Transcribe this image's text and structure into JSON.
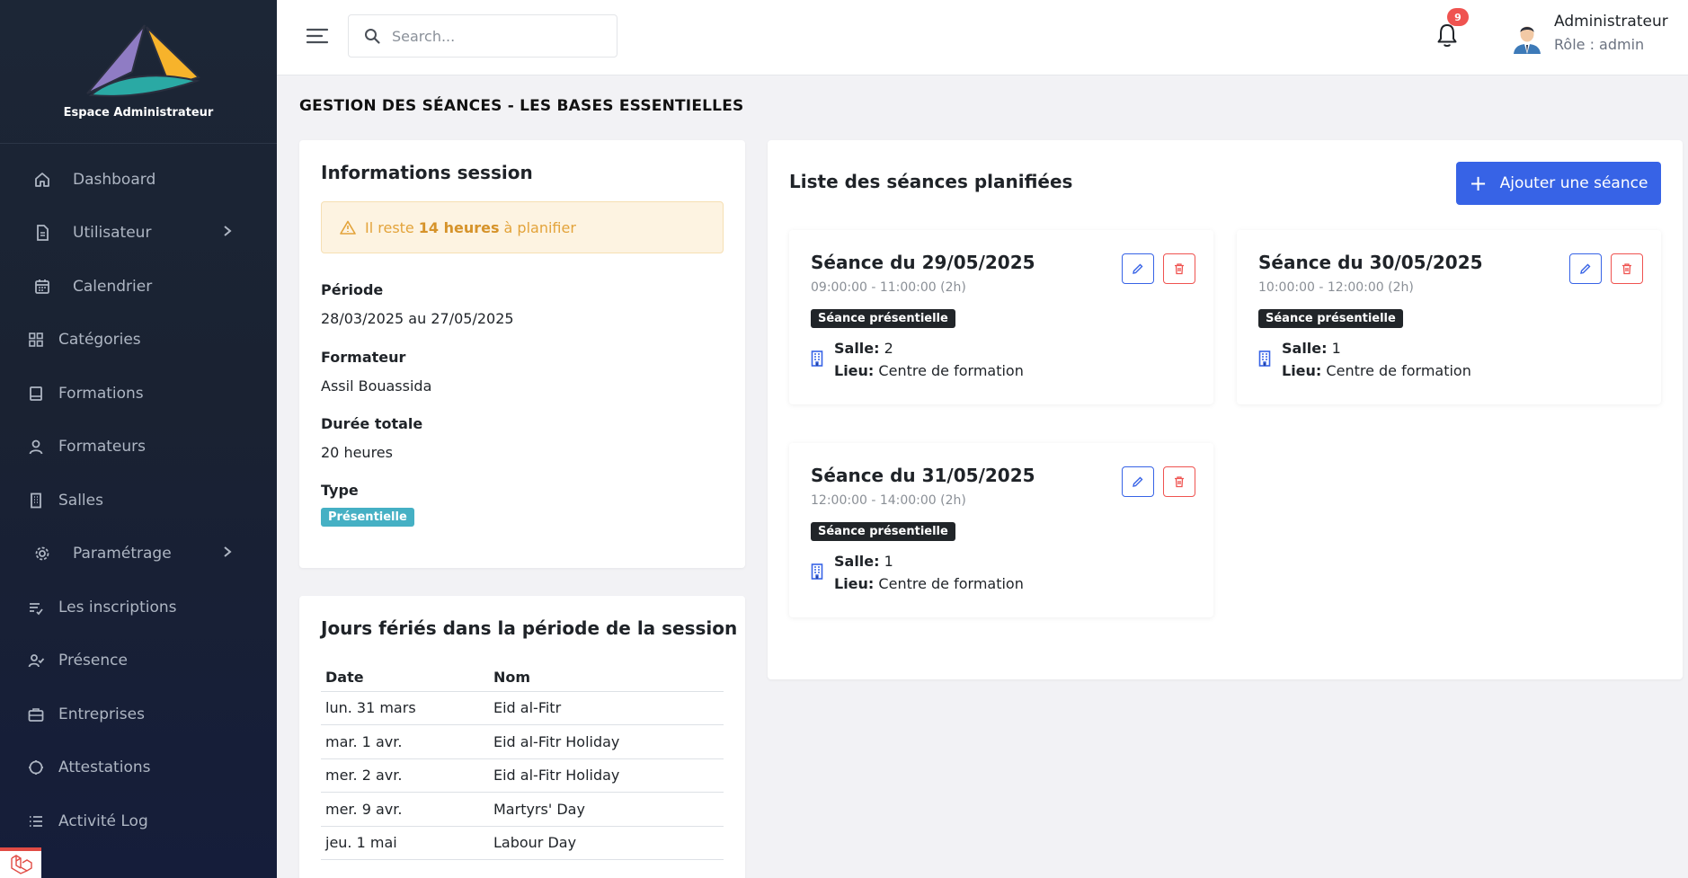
{
  "sidebar": {
    "brand_name": "Espace Administrateur",
    "items": [
      {
        "label": "Dashboard",
        "icon": "home-icon"
      },
      {
        "label": "Utilisateur",
        "icon": "document-icon",
        "has_submenu": true
      },
      {
        "label": "Calendrier",
        "icon": "calendar-icon"
      },
      {
        "label": "Catégories",
        "icon": "grid-icon"
      },
      {
        "label": "Formations",
        "icon": "book-icon"
      },
      {
        "label": "Formateurs",
        "icon": "user-icon"
      },
      {
        "label": "Salles",
        "icon": "building-icon"
      },
      {
        "label": "Paramétrage",
        "icon": "gear-icon",
        "has_submenu": true
      },
      {
        "label": "Les inscriptions",
        "icon": "list-check-icon"
      },
      {
        "label": "Présence",
        "icon": "user-check-icon"
      },
      {
        "label": "Entreprises",
        "icon": "briefcase-icon"
      },
      {
        "label": "Attestations",
        "icon": "badge-icon"
      },
      {
        "label": "Activité Log",
        "icon": "list-icon"
      }
    ]
  },
  "topbar": {
    "search_placeholder": "Search...",
    "notification_count": "9",
    "user_name": "Administrateur",
    "user_role": "Rôle : admin"
  },
  "page": {
    "title": "GESTION DES SÉANCES - LES BASES ESSENTIELLES"
  },
  "info": {
    "title": "Informations session",
    "alert_prefix": "Il reste",
    "alert_highlight": "14 heures",
    "alert_suffix": "à planifier",
    "periode_label": "Période",
    "periode_value": "28/03/2025 au 27/05/2025",
    "formateur_label": "Formateur",
    "formateur_value": "Assil Bouassida",
    "duree_label": "Durée totale",
    "duree_value": "20 heures",
    "type_label": "Type",
    "type_value": "Présentielle"
  },
  "holidays": {
    "title": "Jours fériés dans la période de la session",
    "columns": [
      "Date",
      "Nom"
    ],
    "rows": [
      {
        "date": "lun. 31 mars",
        "name": "Eid al-Fitr"
      },
      {
        "date": "mar. 1 avr.",
        "name": "Eid al-Fitr Holiday"
      },
      {
        "date": "mer. 2 avr.",
        "name": "Eid al-Fitr Holiday"
      },
      {
        "date": "mer. 9 avr.",
        "name": "Martyrs' Day"
      },
      {
        "date": "jeu. 1 mai",
        "name": "Labour Day"
      }
    ]
  },
  "seances": {
    "title": "Liste des séances planifiées",
    "add_label": "Ajouter une séance",
    "salle_label": "Salle:",
    "lieu_label": "Lieu:",
    "items": [
      {
        "title": "Séance du 29/05/2025",
        "time": "09:00:00 - 11:00:00 (2h)",
        "badge": "Séance présentielle",
        "salle": "2",
        "lieu": "Centre de formation"
      },
      {
        "title": "Séance du 30/05/2025",
        "time": "10:00:00 - 12:00:00 (2h)",
        "badge": "Séance présentielle",
        "salle": "1",
        "lieu": "Centre de formation"
      },
      {
        "title": "Séance du 31/05/2025",
        "time": "12:00:00 - 14:00:00 (2h)",
        "badge": "Séance présentielle",
        "salle": "1",
        "lieu": "Centre de formation"
      }
    ]
  },
  "colors": {
    "sidebar_bg": "#1c2636",
    "accent": "#3763e6",
    "danger": "#ef5350",
    "warning_text": "#e3a33a",
    "type_badge": "#45b0c4",
    "dark_badge": "#212529"
  }
}
